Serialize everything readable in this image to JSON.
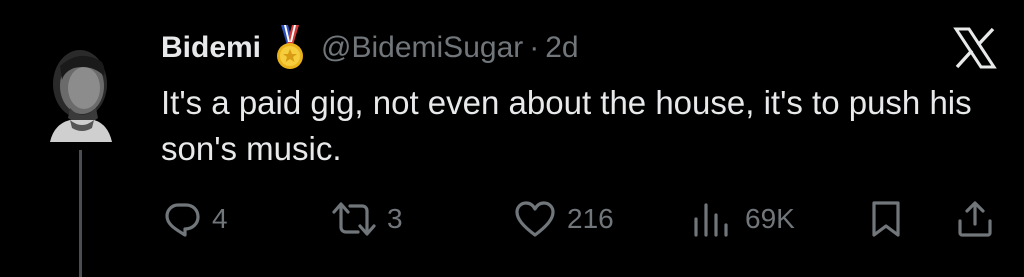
{
  "tweet": {
    "display_name": "Bidemi",
    "handle": "@BidemiSugar",
    "separator": "·",
    "age": "2d",
    "text": "It's a paid gig, not even about the house, it's to push his son's music."
  },
  "badge_icon": "gold-medal-icon",
  "platform_logo": "x-logo-icon",
  "actions": {
    "reply": {
      "icon": "reply-bubble-icon",
      "count": "4"
    },
    "repost": {
      "icon": "repost-arrows-icon",
      "count": "3"
    },
    "like": {
      "icon": "heart-icon",
      "count": "216"
    },
    "views": {
      "icon": "views-bars-icon",
      "count": "69K"
    },
    "bookmark": {
      "icon": "bookmark-icon"
    },
    "share": {
      "icon": "share-upload-icon"
    }
  },
  "colors": {
    "background": "#000000",
    "text_primary": "#e7e9ea",
    "text_secondary": "#71767b",
    "thread_line": "#4a4d51"
  }
}
